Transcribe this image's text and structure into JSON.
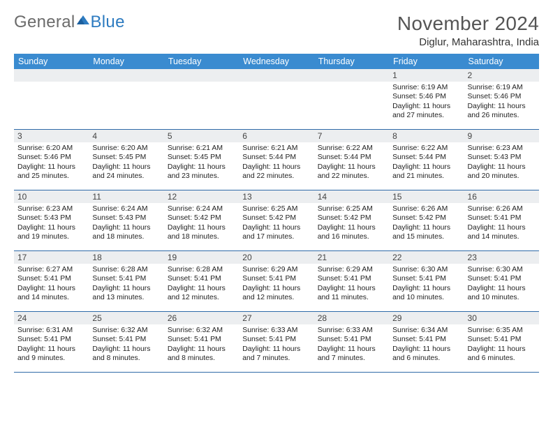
{
  "logo": {
    "part1": "General",
    "part2": "Blue"
  },
  "title": {
    "month": "November 2024",
    "location": "Diglur, Maharashtra, India"
  },
  "weekdays": [
    "Sunday",
    "Monday",
    "Tuesday",
    "Wednesday",
    "Thursday",
    "Friday",
    "Saturday"
  ],
  "weeks": [
    [
      null,
      null,
      null,
      null,
      null,
      {
        "d": "1",
        "sr": "6:19 AM",
        "ss": "5:46 PM",
        "dl": "11 hours and 27 minutes."
      },
      {
        "d": "2",
        "sr": "6:19 AM",
        "ss": "5:46 PM",
        "dl": "11 hours and 26 minutes."
      }
    ],
    [
      {
        "d": "3",
        "sr": "6:20 AM",
        "ss": "5:46 PM",
        "dl": "11 hours and 25 minutes."
      },
      {
        "d": "4",
        "sr": "6:20 AM",
        "ss": "5:45 PM",
        "dl": "11 hours and 24 minutes."
      },
      {
        "d": "5",
        "sr": "6:21 AM",
        "ss": "5:45 PM",
        "dl": "11 hours and 23 minutes."
      },
      {
        "d": "6",
        "sr": "6:21 AM",
        "ss": "5:44 PM",
        "dl": "11 hours and 22 minutes."
      },
      {
        "d": "7",
        "sr": "6:22 AM",
        "ss": "5:44 PM",
        "dl": "11 hours and 22 minutes."
      },
      {
        "d": "8",
        "sr": "6:22 AM",
        "ss": "5:44 PM",
        "dl": "11 hours and 21 minutes."
      },
      {
        "d": "9",
        "sr": "6:23 AM",
        "ss": "5:43 PM",
        "dl": "11 hours and 20 minutes."
      }
    ],
    [
      {
        "d": "10",
        "sr": "6:23 AM",
        "ss": "5:43 PM",
        "dl": "11 hours and 19 minutes."
      },
      {
        "d": "11",
        "sr": "6:24 AM",
        "ss": "5:43 PM",
        "dl": "11 hours and 18 minutes."
      },
      {
        "d": "12",
        "sr": "6:24 AM",
        "ss": "5:42 PM",
        "dl": "11 hours and 18 minutes."
      },
      {
        "d": "13",
        "sr": "6:25 AM",
        "ss": "5:42 PM",
        "dl": "11 hours and 17 minutes."
      },
      {
        "d": "14",
        "sr": "6:25 AM",
        "ss": "5:42 PM",
        "dl": "11 hours and 16 minutes."
      },
      {
        "d": "15",
        "sr": "6:26 AM",
        "ss": "5:42 PM",
        "dl": "11 hours and 15 minutes."
      },
      {
        "d": "16",
        "sr": "6:26 AM",
        "ss": "5:41 PM",
        "dl": "11 hours and 14 minutes."
      }
    ],
    [
      {
        "d": "17",
        "sr": "6:27 AM",
        "ss": "5:41 PM",
        "dl": "11 hours and 14 minutes."
      },
      {
        "d": "18",
        "sr": "6:28 AM",
        "ss": "5:41 PM",
        "dl": "11 hours and 13 minutes."
      },
      {
        "d": "19",
        "sr": "6:28 AM",
        "ss": "5:41 PM",
        "dl": "11 hours and 12 minutes."
      },
      {
        "d": "20",
        "sr": "6:29 AM",
        "ss": "5:41 PM",
        "dl": "11 hours and 12 minutes."
      },
      {
        "d": "21",
        "sr": "6:29 AM",
        "ss": "5:41 PM",
        "dl": "11 hours and 11 minutes."
      },
      {
        "d": "22",
        "sr": "6:30 AM",
        "ss": "5:41 PM",
        "dl": "11 hours and 10 minutes."
      },
      {
        "d": "23",
        "sr": "6:30 AM",
        "ss": "5:41 PM",
        "dl": "11 hours and 10 minutes."
      }
    ],
    [
      {
        "d": "24",
        "sr": "6:31 AM",
        "ss": "5:41 PM",
        "dl": "11 hours and 9 minutes."
      },
      {
        "d": "25",
        "sr": "6:32 AM",
        "ss": "5:41 PM",
        "dl": "11 hours and 8 minutes."
      },
      {
        "d": "26",
        "sr": "6:32 AM",
        "ss": "5:41 PM",
        "dl": "11 hours and 8 minutes."
      },
      {
        "d": "27",
        "sr": "6:33 AM",
        "ss": "5:41 PM",
        "dl": "11 hours and 7 minutes."
      },
      {
        "d": "28",
        "sr": "6:33 AM",
        "ss": "5:41 PM",
        "dl": "11 hours and 7 minutes."
      },
      {
        "d": "29",
        "sr": "6:34 AM",
        "ss": "5:41 PM",
        "dl": "11 hours and 6 minutes."
      },
      {
        "d": "30",
        "sr": "6:35 AM",
        "ss": "5:41 PM",
        "dl": "11 hours and 6 minutes."
      }
    ]
  ],
  "labels": {
    "sunrise": "Sunrise: ",
    "sunset": "Sunset: ",
    "daylight": "Daylight: "
  }
}
